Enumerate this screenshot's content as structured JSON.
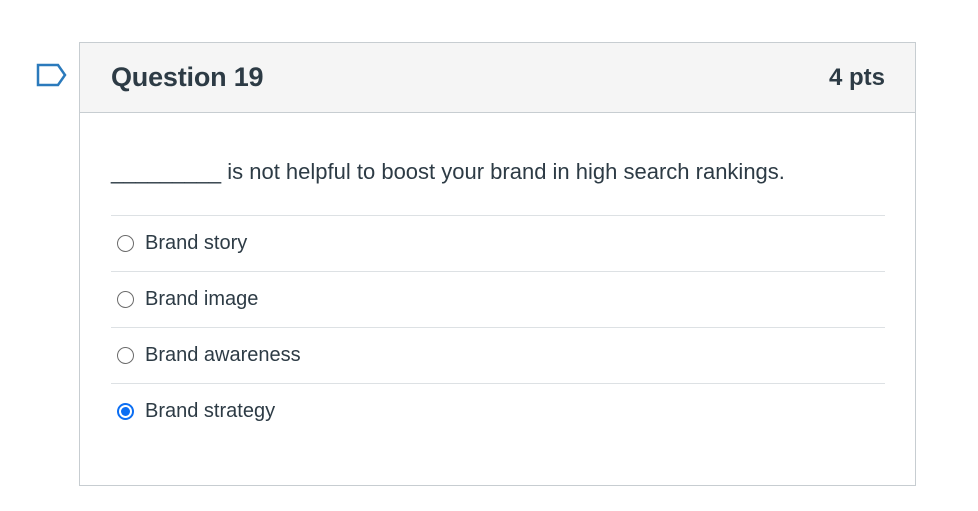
{
  "question": {
    "title": "Question 19",
    "points": "4 pts",
    "text": "_________ is not helpful to boost your brand in high search rankings.",
    "flag_icon": "bookmark-flag-icon",
    "answers": [
      {
        "label": "Brand story",
        "selected": false
      },
      {
        "label": "Brand image",
        "selected": false
      },
      {
        "label": "Brand awareness",
        "selected": false
      },
      {
        "label": "Brand strategy",
        "selected": true
      }
    ]
  },
  "colors": {
    "accent": "#0b6ef3",
    "flag": "#2b7abc",
    "header_bg": "#f5f5f5",
    "text": "#2d3b45"
  }
}
